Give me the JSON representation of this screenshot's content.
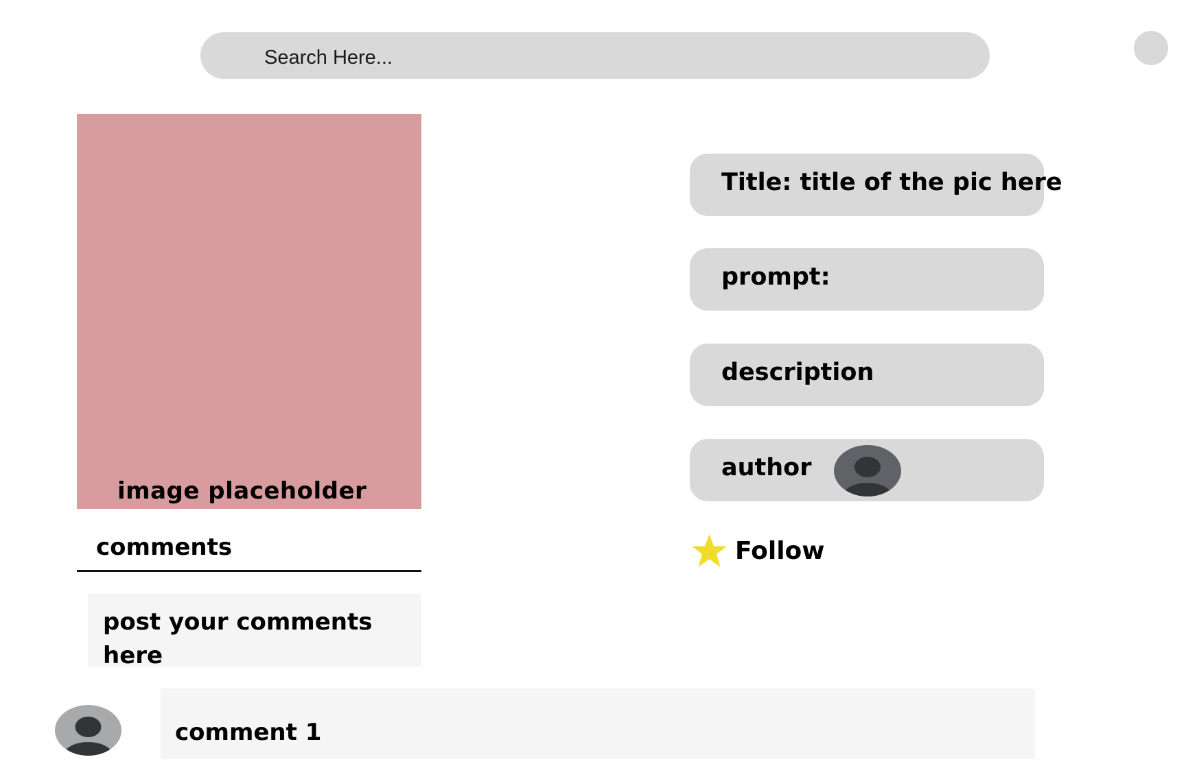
{
  "search": {
    "placeholder": "Search Here..."
  },
  "header": {
    "profile_icon": "avatar-circle"
  },
  "image": {
    "caption": "image placeholder",
    "color": "#d99c9e"
  },
  "comments": {
    "label": "comments",
    "input_placeholder": "post your comments here",
    "items": [
      {
        "text": "comment 1",
        "avatar_icon": "user-icon"
      }
    ]
  },
  "details": {
    "title": "Title: title of the pic here",
    "prompt": "prompt:",
    "description": "description",
    "author_label": "author",
    "author_avatar_icon": "user-icon"
  },
  "follow": {
    "label": "Follow",
    "icon": "star-icon",
    "star_color": "#f2dc2a"
  },
  "colors": {
    "panel_bg": "#d9d9d9",
    "input_bg": "#f5f5f5",
    "avatar_dark": "#5f6368",
    "avatar_light": "#a8a9ab"
  }
}
